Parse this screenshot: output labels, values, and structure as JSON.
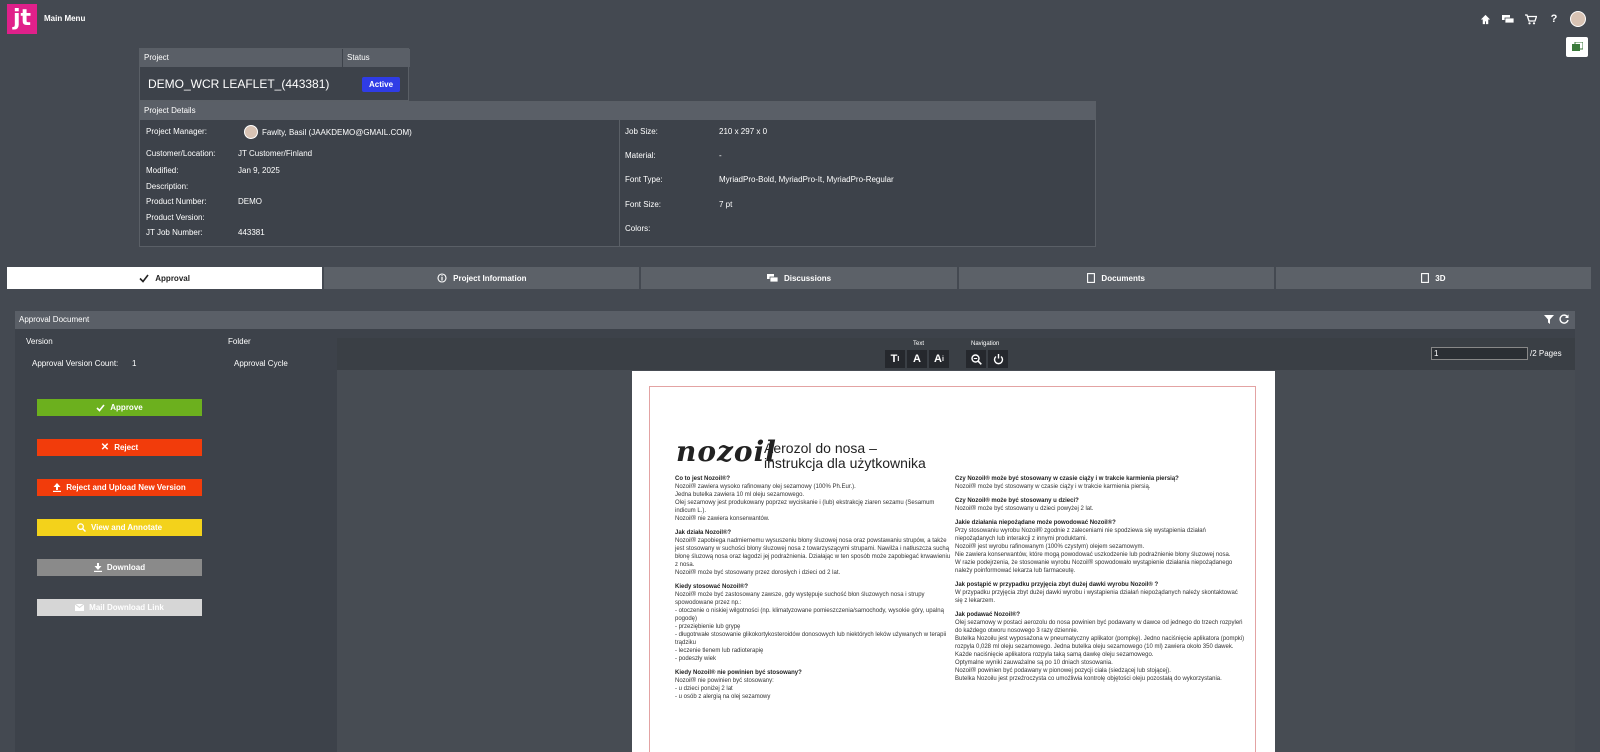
{
  "header": {
    "logo_text": "jt",
    "menu_label": "Main Menu"
  },
  "top_icons": [
    "home-icon",
    "chat-icon",
    "cart-icon",
    "help-icon",
    "user-avatar"
  ],
  "project": {
    "col_project": "Project",
    "col_status": "Status",
    "name": "DEMO_WCR LEAFLET_(443381)",
    "status": "Active"
  },
  "details": {
    "title": "Project Details",
    "left": [
      {
        "label": "Project Manager:",
        "value": "Fawlty, Basil (JAAKDEMO@GMAIL.COM)"
      },
      {
        "label": "Customer/Location:",
        "value": "JT Customer/Finland"
      },
      {
        "label": "Modified:",
        "value": "Jan 9, 2025"
      },
      {
        "label": "Description:",
        "value": ""
      },
      {
        "label": "Product Number:",
        "value": "DEMO"
      },
      {
        "label": "Product Version:",
        "value": ""
      },
      {
        "label": "JT Job Number:",
        "value": "443381"
      }
    ],
    "right": [
      {
        "label": "Job Size:",
        "value": "210 x 297 x 0"
      },
      {
        "label": "Material:",
        "value": "-"
      },
      {
        "label": "Font Type:",
        "value": "MyriadPro-Bold, MyriadPro-It, MyriadPro-Regular"
      },
      {
        "label": "Font Size:",
        "value": "7 pt"
      },
      {
        "label": "Colors:",
        "value": ""
      }
    ]
  },
  "tabs": [
    {
      "label": "Approval",
      "icon": "check-icon",
      "active": true
    },
    {
      "label": "Project Information",
      "icon": "info-icon",
      "active": false
    },
    {
      "label": "Discussions",
      "icon": "chat-icon",
      "active": false
    },
    {
      "label": "Documents",
      "icon": "document-icon",
      "active": false
    },
    {
      "label": "3D",
      "icon": "document-icon",
      "active": false
    }
  ],
  "approval": {
    "title": "Approval Document",
    "version_head": "Version",
    "folder_head": "Folder",
    "version_count_label": "Approval Version Count:",
    "version_count": "1",
    "folder_value": "Approval Cycle",
    "buttons": {
      "approve": "Approve",
      "reject": "Reject",
      "reject_upload": "Reject and Upload New Version",
      "view_annotate": "View and Annotate",
      "download": "Download",
      "mail_link": "Mail Download Link"
    },
    "button_colors": {
      "approve": "#6cb01e",
      "reject": "#f23c0b",
      "reject_upload": "#f23c0b",
      "view_annotate": "#f3d21b",
      "download": "#8a8a8a",
      "mail_link": "#d6d6d6"
    }
  },
  "viewer": {
    "text_group": "Text",
    "nav_group": "Navigation",
    "page_value": "1",
    "page_suffix": "/2 Pages"
  },
  "document": {
    "brand": "nozoil",
    "title_line1": "Aerozol do nosa –",
    "title_line2": "instrukcja dla użytkownika",
    "left_col": [
      {
        "h": "Co to jest Nozoil®?"
      },
      {
        "t": "Nozoil® zawiera wysoko rafinowany olej sezamowy (100% Ph.Eur.)."
      },
      {
        "t": "Jedna butelka zawiera 10 ml oleju sezamowego."
      },
      {
        "t": "Olej sezamowy jest produkowany poprzez wyciskanie i (lub) ekstrakcję ziaren sezamu (Sesamum indicum L.)."
      },
      {
        "t": "Nozoil® nie zawiera konserwantów."
      },
      {
        "h": "Jak działa Nozoil®?"
      },
      {
        "t": "Nozoil® zapobiega nadmiernemu wysuszeniu błony śluzowej nosa oraz powstawaniu strupów, a także jest stosowany w suchości błony śluzowej nosa z towarzyszącymi strupami. Nawilża i natłuszcza suchą błonę śluzową nosa oraz łagodzi jej podrażnienia. Działając w ten sposób może zapobiegać krwawieniu z nosa."
      },
      {
        "t": "Nozoil® może być stosowany przez dorosłych i dzieci od 2 lat."
      },
      {
        "h": "Kiedy stosować Nozoil®?"
      },
      {
        "t": "Nozoil® może być zastosowany zawsze, gdy występuje suchość błon śluzowych nosa i strupy spowodowane przez np.:"
      },
      {
        "t": "- otoczenie o niskiej wilgotności (np. klimatyzowane pomieszczenia/samochody, wysokie góry, upalną pogodę)"
      },
      {
        "t": "- przeziębienie lub grypę"
      },
      {
        "t": "- długotrwałe stosowanie glikokortykosteroidów donosowych lub niektórych leków używanych w terapii trądziku"
      },
      {
        "t": "- leczenie tlenem lub radioterapię"
      },
      {
        "t": "- podeszły wiek"
      },
      {
        "h": "Kiedy Nozoil® nie powinien być stosowany?"
      },
      {
        "t": "Nozoil® nie powinien być stosowany:"
      },
      {
        "t": "- u dzieci poniżej 2 lat"
      },
      {
        "t": "- u osób z alergią na olej sezamowy"
      }
    ],
    "right_col": [
      {
        "h": "Czy Nozoil® może być stosowany w czasie ciąży i w trakcie karmienia piersią?"
      },
      {
        "t": "Nozoil® może być stosowany w czasie ciąży i w trakcie karmienia piersią."
      },
      {
        "h": "Czy Nozoil® może być stosowany u dzieci?"
      },
      {
        "t": "Nozoil® może być stosowany u dzieci powyżej 2 lat."
      },
      {
        "h": "Jakie działania niepożądane może powodować Nozoil®?"
      },
      {
        "t": "Przy stosowaniu wyrobu Nozoil® zgodnie z zaleceniami nie spodziewa się wystąpienia działań niepożądanych lub interakcji z innymi produktami."
      },
      {
        "t": "Nozoil® jest wyrobu rafinowanym (100% czystym) olejem sezamowym."
      },
      {
        "t": "Nie zawiera konserwantów, które mogą powodować uszkodzenie lub podrażnienie błony śluzowej nosa."
      },
      {
        "t": "W razie podejrzenia, że stosowanie wyrobu Nozoil® spowodowało wystąpienie działania niepożądanego należy poinformować lekarza lub farmaceutę."
      },
      {
        "h": "Jak postąpić w przypadku przyjęcia zbyt dużej dawki wyrobu Nozoil® ?"
      },
      {
        "t": "W przypadku przyjęcia zbyt dużej dawki wyrobu i wystąpienia działań niepożądanych należy skontaktować się z lekarzem."
      },
      {
        "h": "Jak podawać Nozoil®?"
      },
      {
        "t": "Olej sezamowy w postaci aerozolu do nosa powinien być podawany w dawce od jednego do trzech rozpyleń do każdego otworu nosowego 3 razy dziennie."
      },
      {
        "t": "Butelka Nozoilu jest wyposażona w pneumatyczny aplikator (pompkę). Jedno naciśnięcie aplikatora (pompki) rozpyla 0,028 ml oleju sezamowego. Jedna butelka oleju sezamowego (10 ml) zawiera około 350 dawek. Każde naciśnięcie aplikatora rozpyla taką samą dawkę oleju sezamowego."
      },
      {
        "t": "Optymalne wyniki zauważalne są po 10 dniach stosowania."
      },
      {
        "t": "Nozoil® powinien być podawany w pionowej pozycji ciała (siedzącej lub stojącej)."
      },
      {
        "t": "Butelka Nozoilu jest przeźroczysta co umożliwia kontrolę objętości oleju pozostałą do wykorzystania."
      }
    ]
  }
}
